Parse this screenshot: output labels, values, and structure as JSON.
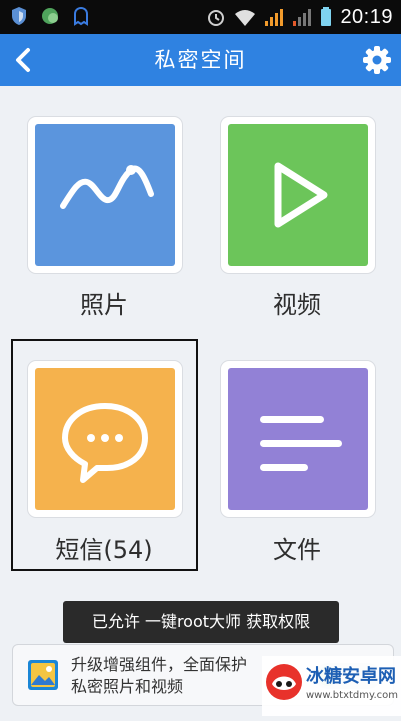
{
  "status_bar": {
    "time": "20:19",
    "icons": [
      "shield-icon",
      "chat-app-icon",
      "ghost-icon",
      "alarm-icon",
      "wifi-icon",
      "signal-icon",
      "signal-icon-2",
      "battery-icon"
    ]
  },
  "app_bar": {
    "title": "私密空间",
    "back_icon": "chevron-left-icon",
    "settings_icon": "gear-icon",
    "color": "#2f82e1"
  },
  "tiles": [
    {
      "label": "照片",
      "icon": "photo-icon",
      "color": "#5b95dd"
    },
    {
      "label": "视频",
      "icon": "play-icon",
      "color": "#6cc55a"
    },
    {
      "label": "短信(54)",
      "icon": "chat-bubble-icon",
      "color": "#f5b24d"
    },
    {
      "label": "文件",
      "icon": "document-lines-icon",
      "color": "#9281d6"
    }
  ],
  "toast": {
    "text": "已允许 一键root大师 获取权限"
  },
  "banner": {
    "line1": "升级增强组件，全面保护",
    "line2": "私密照片和视频",
    "toggle_on": false
  },
  "watermark": {
    "title": "冰糖安卓网",
    "url": "www.btxtdmy.com"
  }
}
